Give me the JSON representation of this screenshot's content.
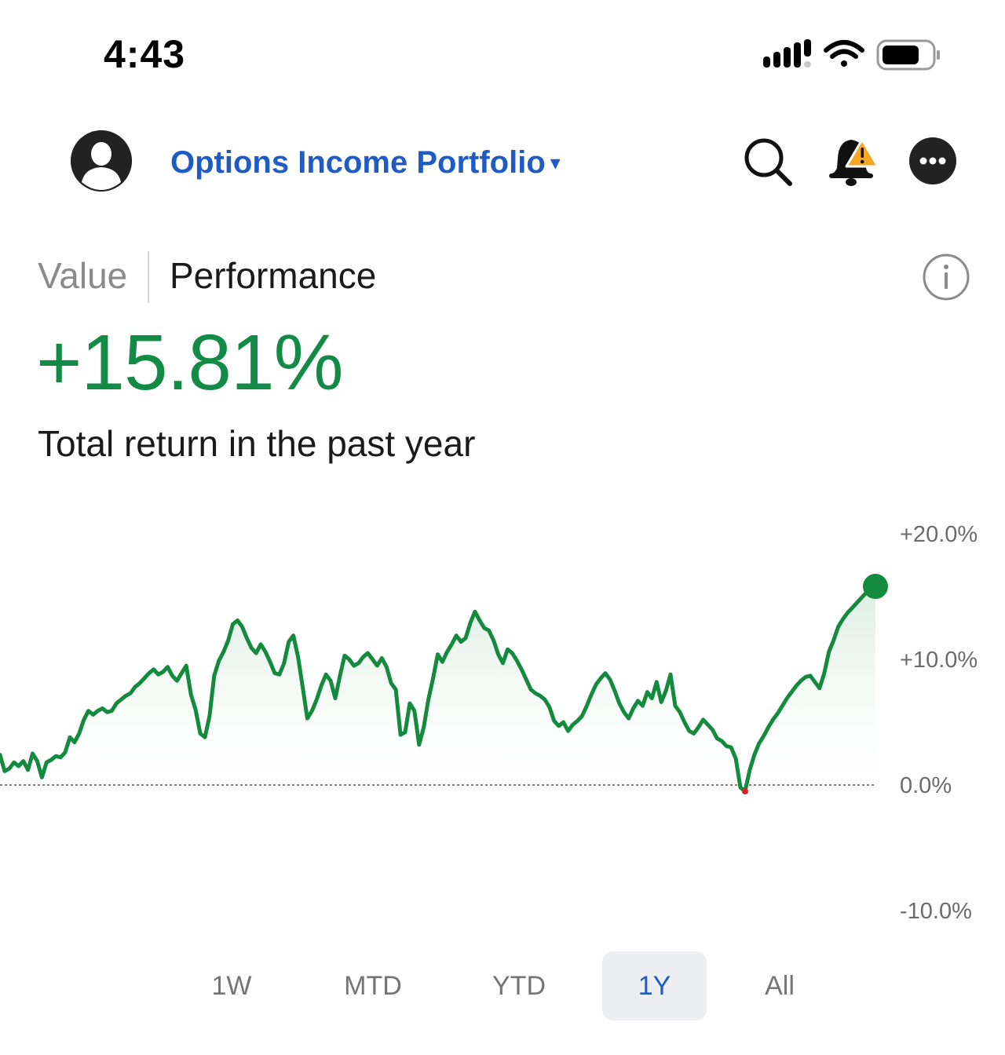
{
  "status_bar": {
    "time": "4:43"
  },
  "header": {
    "portfolio_name": "Options Income Portfolio",
    "caret": "▾",
    "icons": [
      "avatar-icon",
      "search-icon",
      "bell-alert-icon",
      "more-icon"
    ]
  },
  "tabs": [
    {
      "label": "Value",
      "active": false
    },
    {
      "label": "Performance",
      "active": true
    }
  ],
  "performance": {
    "value": "+15.81%",
    "label": "Total return in the past year"
  },
  "chart_data": {
    "type": "line",
    "period": "1Y",
    "y_ticks": [
      "+20.0%",
      "+10.0%",
      "0.0%",
      "-10.0%"
    ],
    "ylim": [
      -10,
      20
    ],
    "baseline": 0,
    "colors": {
      "line": "#148a3e",
      "negative": "#e0201e",
      "fill": "#e6f3ea"
    },
    "series": [
      {
        "values": [
          2.4,
          1.1,
          1.3,
          1.8,
          1.5,
          1.9,
          1.2,
          2.5,
          1.9,
          0.6,
          1.8,
          2.0,
          2.3,
          2.2,
          2.6,
          3.8,
          3.4,
          4.1,
          5.2,
          5.9,
          5.6,
          5.9,
          6.1,
          5.8,
          5.9,
          6.5,
          6.8,
          7.1,
          7.3,
          7.8,
          8.1,
          8.5,
          8.9,
          9.2,
          8.8,
          9.0,
          9.4,
          8.7,
          8.3,
          8.9,
          9.5,
          7.2,
          6.0,
          4.1,
          3.8,
          5.5,
          8.7,
          9.9,
          10.6,
          11.5,
          12.8,
          13.1,
          12.6,
          11.7,
          10.9,
          10.5,
          11.2,
          10.6,
          9.8,
          8.9,
          8.8,
          9.7,
          11.4,
          11.9,
          10.2,
          7.8,
          5.3,
          5.9,
          6.8,
          7.9,
          8.8,
          8.3,
          6.9,
          8.7,
          10.3,
          10.0,
          9.5,
          9.7,
          10.2,
          10.5,
          10.0,
          9.5,
          10.1,
          9.4,
          8.1,
          7.6,
          4.0,
          4.2,
          6.5,
          5.9,
          3.2,
          4.6,
          6.8,
          8.5,
          10.4,
          9.8,
          10.6,
          11.2,
          11.9,
          11.4,
          11.7,
          12.9,
          13.8,
          13.1,
          12.5,
          12.3,
          11.5,
          10.4,
          9.7,
          10.8,
          10.5,
          9.9,
          9.2,
          8.4,
          7.6,
          7.3,
          7.1,
          6.8,
          6.2,
          5.1,
          4.7,
          5.0,
          4.3,
          4.8,
          5.1,
          5.5,
          6.3,
          7.2,
          8.0,
          8.5,
          8.9,
          8.4,
          7.5,
          6.5,
          5.8,
          5.3,
          6.1,
          6.7,
          6.3,
          7.4,
          6.9,
          8.2,
          6.6,
          7.5,
          8.8,
          6.3,
          5.8,
          5.0,
          4.3,
          4.1,
          4.6,
          5.2,
          4.8,
          4.4,
          3.7,
          3.5,
          3.1,
          3.0,
          2.1,
          -0.2,
          -0.5,
          1.2,
          2.4,
          3.3,
          3.9,
          4.6,
          5.2,
          5.7,
          6.3,
          6.9,
          7.4,
          7.9,
          8.3,
          8.6,
          8.7,
          8.2,
          7.7,
          8.9,
          10.6,
          11.5,
          12.6,
          13.2,
          13.7,
          14.1,
          14.5,
          14.9,
          15.3,
          15.6,
          15.81
        ]
      }
    ]
  },
  "ranges": [
    {
      "label": "1W",
      "active": false
    },
    {
      "label": "MTD",
      "active": false
    },
    {
      "label": "YTD",
      "active": false
    },
    {
      "label": "1Y",
      "active": true
    },
    {
      "label": "All",
      "active": false
    }
  ]
}
